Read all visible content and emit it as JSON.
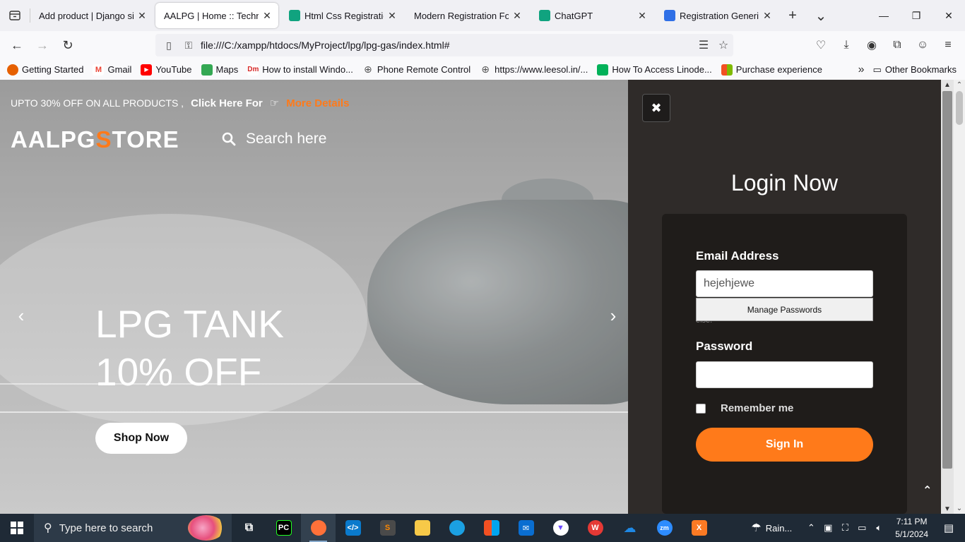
{
  "browser": {
    "tabs": [
      {
        "title": "Add product | Django site a",
        "favicon_color": "#ffffff",
        "active": false
      },
      {
        "title": "AALPG | Home :: Technolo",
        "favicon_color": "#ffffff",
        "active": true
      },
      {
        "title": "Html Css Registration F",
        "favicon_color": "#10a37f",
        "active": false
      },
      {
        "title": "Modern Registration Form",
        "favicon_color": "#ffffff",
        "active": false
      },
      {
        "title": "ChatGPT",
        "favicon_color": "#10a37f",
        "active": false
      },
      {
        "title": "Registration Generic D",
        "favicon_color": "#2f6fe6",
        "active": false
      }
    ],
    "url": "file:///C:/xampp/htdocs/MyProject/lpg/lpg-gas/index.html#",
    "bookmarks": [
      {
        "label": "Getting Started",
        "icon": "firefox-icon",
        "color": "#e66000"
      },
      {
        "label": "Gmail",
        "icon": "gmail-icon",
        "color": "#ea4335"
      },
      {
        "label": "YouTube",
        "icon": "youtube-icon",
        "color": "#ff0000"
      },
      {
        "label": "Maps",
        "icon": "maps-icon",
        "color": "#34a853"
      },
      {
        "label": "How to install Windo...",
        "icon": "dm-icon",
        "color": "#d62828"
      },
      {
        "label": "Phone Remote Control",
        "icon": "globe-icon",
        "color": "#555555"
      },
      {
        "label": "https://www.leesol.in/...",
        "icon": "globe-icon",
        "color": "#555555"
      },
      {
        "label": "How To Access Linode...",
        "icon": "linode-icon",
        "color": "#02b159"
      },
      {
        "label": "Purchase experience",
        "icon": "microsoft-icon",
        "color": "#f25022"
      }
    ],
    "other_bookmarks": "Other Bookmarks"
  },
  "site": {
    "promo_text": "UPTO 30% OFF ON ALL PRODUCTS ,",
    "promo_click": "Click Here For",
    "promo_link": "More Details",
    "logo_part1": "AALPG",
    "logo_s": "S",
    "logo_part2": "TORE",
    "search_placeholder": "Search here",
    "headline_line1": "LPG TANK",
    "headline_line2": "10% OFF",
    "shop_button": "Shop Now",
    "accent_color": "#ff7a1a"
  },
  "login": {
    "title": "Login Now",
    "email_label": "Email Address",
    "email_value": "hejehjewe",
    "autofill_option": "Manage Passwords",
    "hint_text": "else.",
    "password_label": "Password",
    "password_value": "",
    "remember_label": "Remember me",
    "signin_button": "Sign In"
  },
  "taskbar": {
    "search_placeholder": "Type here to search",
    "weather": "Rain...",
    "time": "7:11 PM",
    "date": "5/1/2024"
  }
}
